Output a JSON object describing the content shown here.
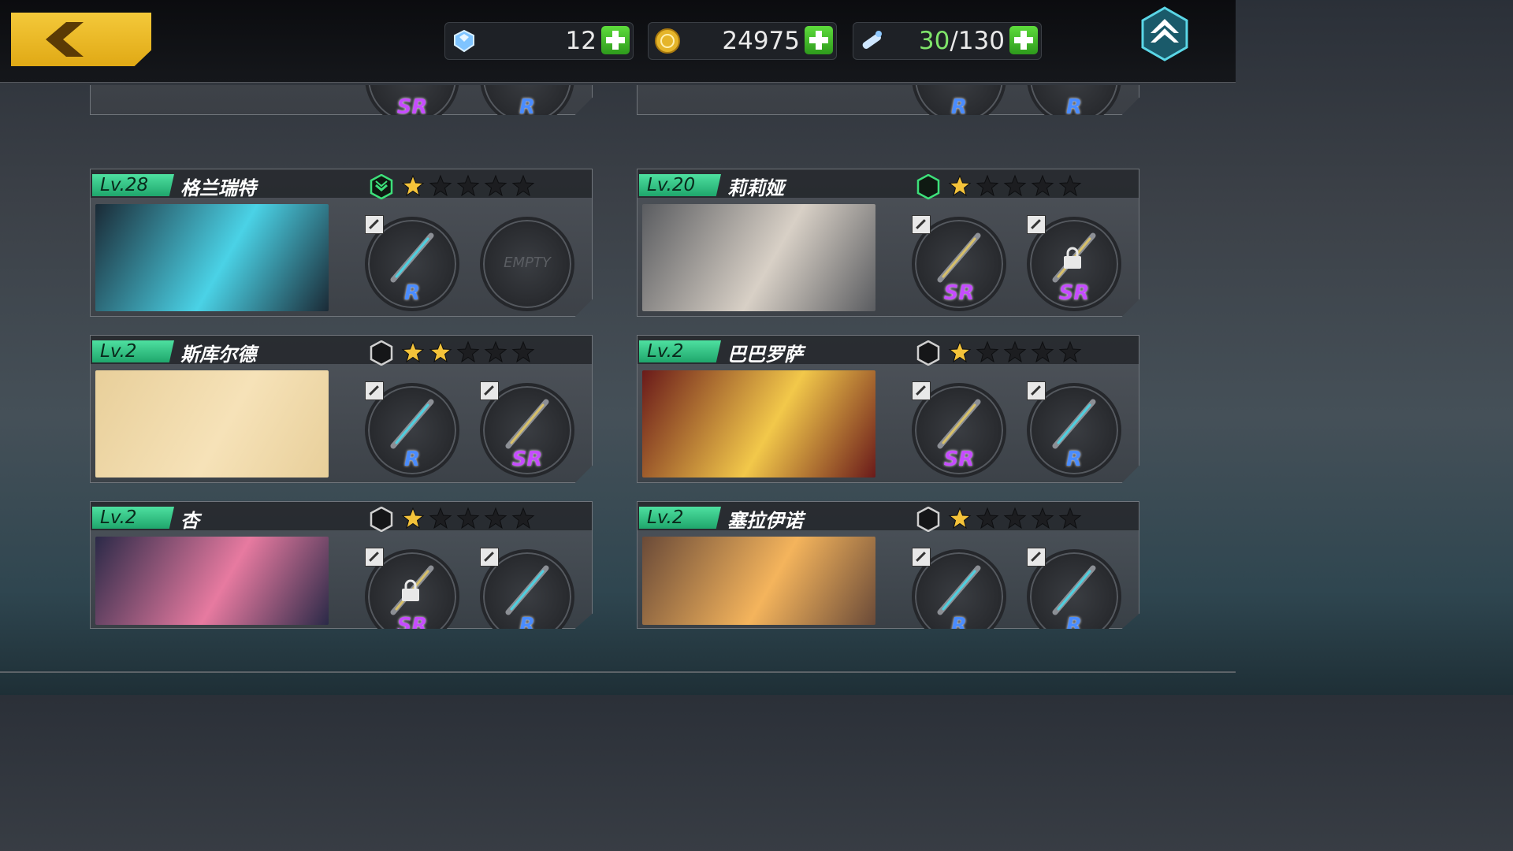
{
  "resources": {
    "gems": {
      "icon": "gem-icon",
      "value": "12"
    },
    "coins": {
      "icon": "coin-icon",
      "value": "24975"
    },
    "stamina": {
      "icon": "stamina-icon",
      "current": "30",
      "separator": "/",
      "max": "130"
    }
  },
  "top_cards": [
    {
      "slots": [
        {
          "rank": "SR"
        },
        {
          "rank": "R"
        }
      ]
    },
    {
      "slots": [
        {
          "rank": "R"
        },
        {
          "rank": "R"
        }
      ]
    }
  ],
  "characters": [
    {
      "level": "Lv.28",
      "name": "格兰瑞特",
      "rank_badge": "up",
      "stars": 1,
      "slots": [
        {
          "rank": "R",
          "weapon": "scythe",
          "locked": false
        },
        {
          "empty": "EMPTY"
        }
      ]
    },
    {
      "level": "Lv.20",
      "name": "莉莉娅",
      "rank_badge": "green",
      "stars": 1,
      "slots": [
        {
          "rank": "SR",
          "weapon": "gauntlet",
          "locked": false
        },
        {
          "rank": "SR",
          "weapon": "gauntlet",
          "locked": true
        }
      ]
    },
    {
      "level": "Lv.2",
      "name": "斯库尔德",
      "rank_badge": "none",
      "stars": 2,
      "slots": [
        {
          "rank": "R",
          "weapon": "staff",
          "locked": false
        },
        {
          "rank": "SR",
          "weapon": "scepter",
          "locked": false
        }
      ]
    },
    {
      "level": "Lv.2",
      "name": "巴巴罗萨",
      "rank_badge": "none",
      "stars": 1,
      "slots": [
        {
          "rank": "SR",
          "weapon": "blades",
          "locked": false
        },
        {
          "rank": "R",
          "weapon": "fish",
          "locked": false
        }
      ]
    },
    {
      "level": "Lv.2",
      "name": "杏",
      "rank_badge": "none",
      "stars": 1,
      "slots": [
        {
          "rank": "SR",
          "weapon": "hook",
          "locked": true
        },
        {
          "rank": "R",
          "weapon": "cane",
          "locked": false
        }
      ]
    },
    {
      "level": "Lv.2",
      "name": "塞拉伊诺",
      "rank_badge": "none",
      "stars": 1,
      "slots": [
        {
          "rank": "R",
          "weapon": "trident",
          "locked": false
        },
        {
          "rank": "R",
          "weapon": "sword",
          "locked": false
        }
      ]
    }
  ],
  "colors": {
    "accent_green": "#2fc27f",
    "star_gold": "#f4c33a",
    "gem_blue": "#6fb8ff",
    "rank_r": "#4a8cff",
    "rank_sr": "#c64cff"
  }
}
